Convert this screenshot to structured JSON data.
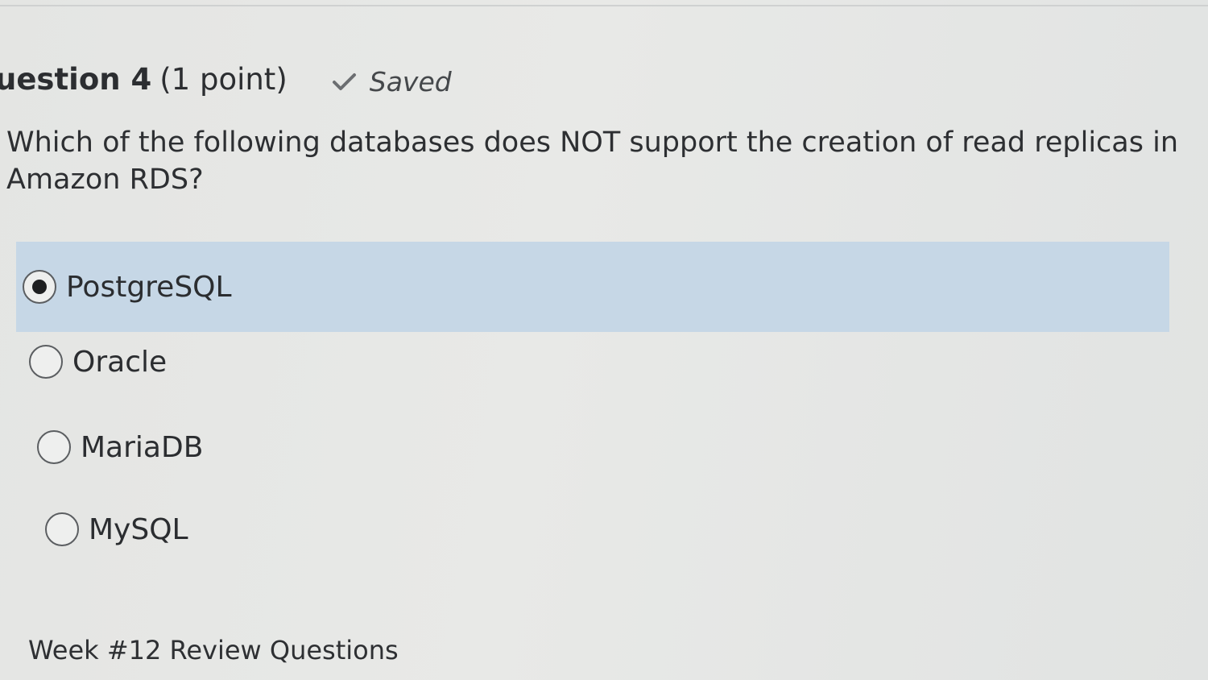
{
  "question": {
    "number": "uestion 4",
    "points": "(1 point)",
    "status": {
      "icon": "check-icon",
      "label": "Saved"
    },
    "text": "Which of the following databases does NOT support the creation of read replicas in Amazon RDS?"
  },
  "answers": [
    {
      "label": "PostgreSQL",
      "selected": true
    },
    {
      "label": "Oracle",
      "selected": false
    },
    {
      "label": "MariaDB",
      "selected": false
    },
    {
      "label": "MySQL",
      "selected": false
    }
  ],
  "footer": {
    "label": "Week #12 Review Questions"
  },
  "colors": {
    "selected_highlight": "#c6d7e6",
    "background": "#e6e7e5",
    "text": "#2d2f32"
  }
}
